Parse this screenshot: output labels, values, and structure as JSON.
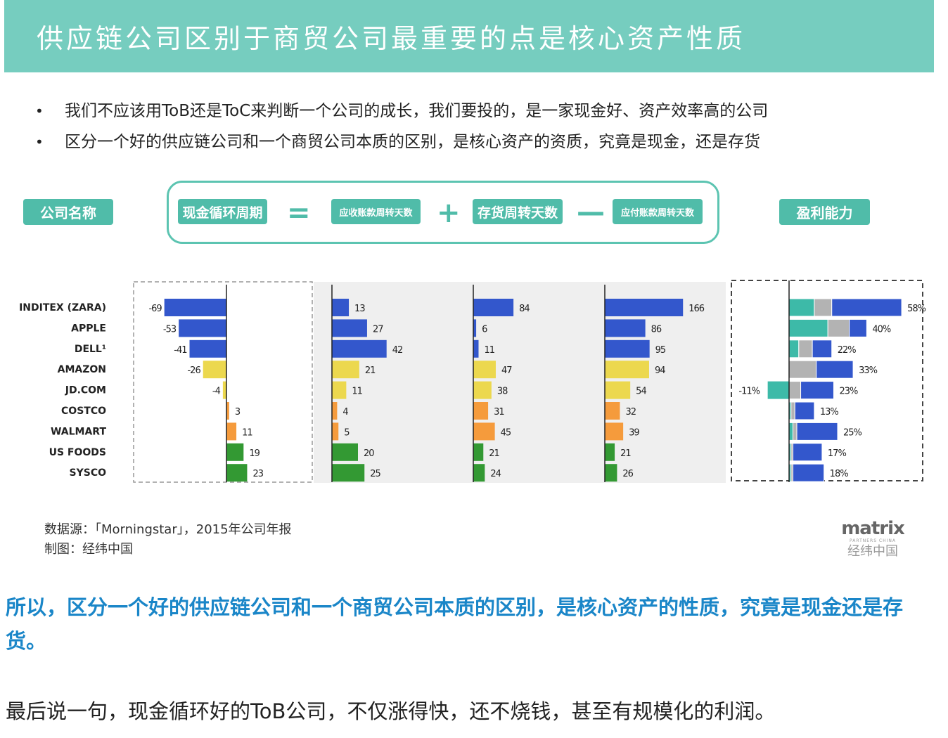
{
  "header": {
    "title": "供应链公司区别于商贸公司最重要的点是核心资产性质"
  },
  "bullets": [
    "我们不应该用ToB还是ToC来判断一个公司的成长，我们要投的，是一家现金好、资产效率高的公司",
    "区分一个好的供应链公司和一个商贸公司本质的区别，是核心资产的资质，究竟是现金，还是存货"
  ],
  "labels": {
    "company": "公司名称",
    "ccc": "现金循环周期",
    "ar_days": "应收账款周转天数",
    "inv_days": "存货周转天数",
    "ap_days": "应付账款周转天数",
    "profit": "盈利能力",
    "op_eq": "=",
    "op_plus": "+",
    "op_minus": "—"
  },
  "colors": {
    "teal": "#50bca9",
    "blue": "#3357cc",
    "yellow": "#ecd84e",
    "orange": "#f59b3c",
    "green": "#339933",
    "gray": "#b3b3b3",
    "teal_bar": "#3dbaa8"
  },
  "chart_data": {
    "type": "bar",
    "categories": [
      "INDITEX (ZARA)",
      "APPLE",
      "DELL¹",
      "AMAZON",
      "JD.COM",
      "COSTCO",
      "WALMART",
      "US FOODS",
      "SYSCO"
    ],
    "series": [
      {
        "name": "现金循环周期",
        "values": [
          -69,
          -53,
          -41,
          -26,
          -4,
          3,
          11,
          19,
          23
        ]
      },
      {
        "name": "应收账款周转天数",
        "values": [
          13,
          27,
          42,
          21,
          11,
          4,
          5,
          20,
          25
        ]
      },
      {
        "name": "存货周转天数",
        "values": [
          84,
          6,
          11,
          47,
          38,
          31,
          45,
          21,
          24
        ]
      },
      {
        "name": "应付账款周转天数",
        "values": [
          166,
          86,
          95,
          94,
          54,
          32,
          39,
          21,
          26
        ]
      }
    ],
    "profitability": {
      "labels": [
        "58%",
        "40%",
        "22%",
        "33%",
        "23%",
        "13%",
        "25%",
        "17%",
        "18%"
      ],
      "segments": [
        [
          {
            "color": "teal",
            "value": 13
          },
          {
            "color": "gray",
            "value": 9
          },
          {
            "color": "blue",
            "value": 36
          }
        ],
        [
          {
            "color": "teal",
            "value": 20
          },
          {
            "color": "gray",
            "value": 11
          },
          {
            "color": "blue",
            "value": 9
          }
        ],
        [
          {
            "color": "teal",
            "value": 5
          },
          {
            "color": "gray",
            "value": 7
          },
          {
            "color": "blue",
            "value": 10
          }
        ],
        [
          {
            "color": "gray",
            "value": 14
          },
          {
            "color": "blue",
            "value": 19
          }
        ],
        [
          {
            "color": "teal",
            "value": -11
          },
          {
            "color": "gray",
            "value": 6
          },
          {
            "color": "blue",
            "value": 17
          }
        ],
        [
          {
            "color": "teal",
            "value": 1
          },
          {
            "color": "gray",
            "value": 2
          },
          {
            "color": "blue",
            "value": 10
          }
        ],
        [
          {
            "color": "teal",
            "value": 2
          },
          {
            "color": "gray",
            "value": 2
          },
          {
            "color": "blue",
            "value": 21
          }
        ],
        [
          {
            "color": "teal",
            "value": 1
          },
          {
            "color": "gray",
            "value": 1
          },
          {
            "color": "blue",
            "value": 15
          }
        ],
        [
          {
            "color": "teal",
            "value": 1
          },
          {
            "color": "gray",
            "value": 1
          },
          {
            "color": "blue",
            "value": 16
          }
        ]
      ],
      "negative_label": "-11%"
    },
    "row_colors": [
      "blue",
      "blue",
      "blue",
      "yellow",
      "yellow",
      "orange",
      "orange",
      "green",
      "green"
    ]
  },
  "footer": {
    "source": "数据源：「Morningstar」，2015年公司年报",
    "made_by": "制图：经纬中国",
    "logo_main": "matrix",
    "logo_sub": "PARTNERS CHINA",
    "logo_cn": "经纬中国"
  },
  "body": {
    "emphasis": "所以，区分一个好的供应链公司和一个商贸公司本质的区别，是核心资产的性质，究竟是现金还是存货。",
    "closing": "最后说一句，现金循环好的ToB公司，不仅涨得快，还不烧钱，甚至有规模化的利润。"
  }
}
